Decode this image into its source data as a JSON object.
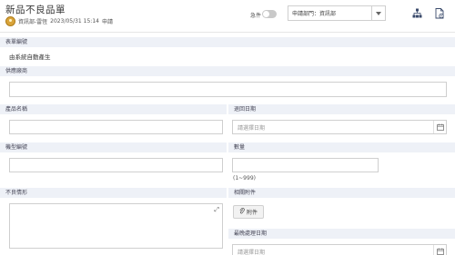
{
  "header": {
    "title": "新品不良品單",
    "author": "資訊部-雷恆",
    "datetime": "2023/05/31 15:14",
    "status": "申請",
    "urgent_label": "急件",
    "department_select": "申請部門：資訊部"
  },
  "form": {
    "form_number_label": "表單編號",
    "form_number_value": "由系統自動產生",
    "supplier_label": "供應廠商",
    "product_name_label": "產品名稱",
    "return_date_label": "退回日期",
    "return_date_placeholder": "請選擇日期",
    "model_number_label": "機型編號",
    "quantity_label": "數量",
    "quantity_hint": "(1~999)",
    "defect_label": "不良情形",
    "attachments_label": "相關附件",
    "attach_button": "附件",
    "final_date_label": "最晚處理日期",
    "final_date_placeholder": "請選擇日期"
  },
  "colors": {
    "section_bg": "#eef1f7",
    "toggle_off": "#c9c9c9",
    "avatar": "#d9a43a"
  },
  "icons": {
    "org_chart": "org-chart-icon",
    "document_settings": "document-settings-icon",
    "calendar": "calendar-icon",
    "expand": "expand-icon",
    "paperclip": "paperclip-icon",
    "dropdown": "chevron-down-icon"
  }
}
